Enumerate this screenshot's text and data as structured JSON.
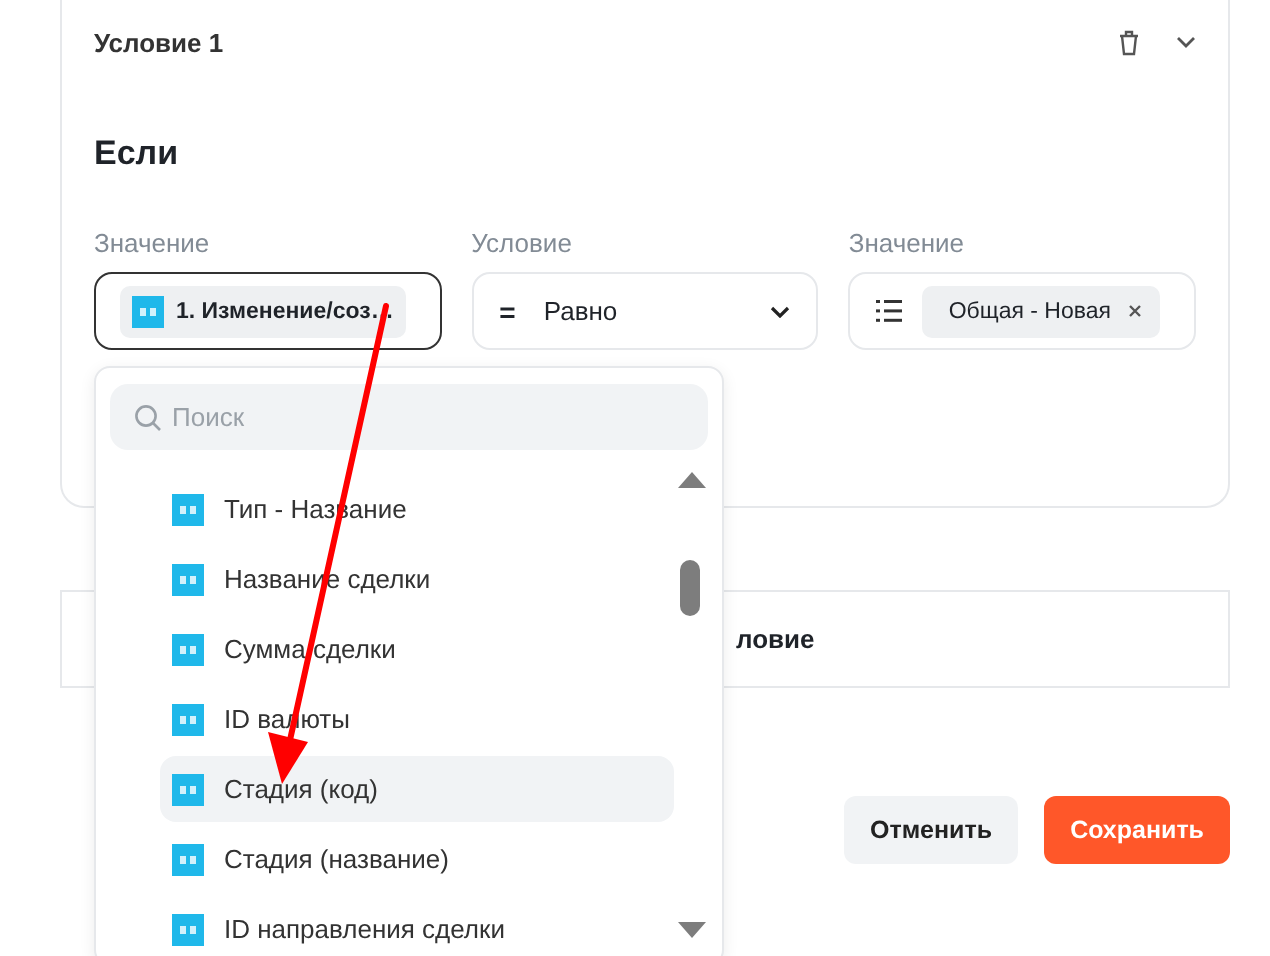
{
  "condition": {
    "title": "Условие 1",
    "heading": "Если",
    "fields": [
      {
        "label": "Значение",
        "kind": "token",
        "value": "1. Изменение/соз…",
        "focused": true
      },
      {
        "label": "Условие",
        "kind": "select",
        "symbol": "=",
        "value": "Равно",
        "focused": false
      },
      {
        "label": "Значение",
        "kind": "tags",
        "tags": [
          "Общая - Новая"
        ],
        "focused": false
      }
    ]
  },
  "dropdown": {
    "search": {
      "placeholder": "Поиск"
    },
    "items": [
      {
        "label": "Тип - Название",
        "selected": false
      },
      {
        "label": "Название сделки",
        "selected": false
      },
      {
        "label": "Сумма сделки",
        "selected": false
      },
      {
        "label": "ID валюты",
        "selected": false
      },
      {
        "label": "Стадия (код)",
        "selected": true
      },
      {
        "label": "Стадия (название)",
        "selected": false
      },
      {
        "label": "ID направления сделки",
        "selected": false
      }
    ]
  },
  "add_box": {
    "label": "ловие"
  },
  "buttons": [
    {
      "label": "Отменить",
      "kind": "secondary"
    },
    {
      "label": "Сохранить",
      "kind": "primary"
    }
  ]
}
